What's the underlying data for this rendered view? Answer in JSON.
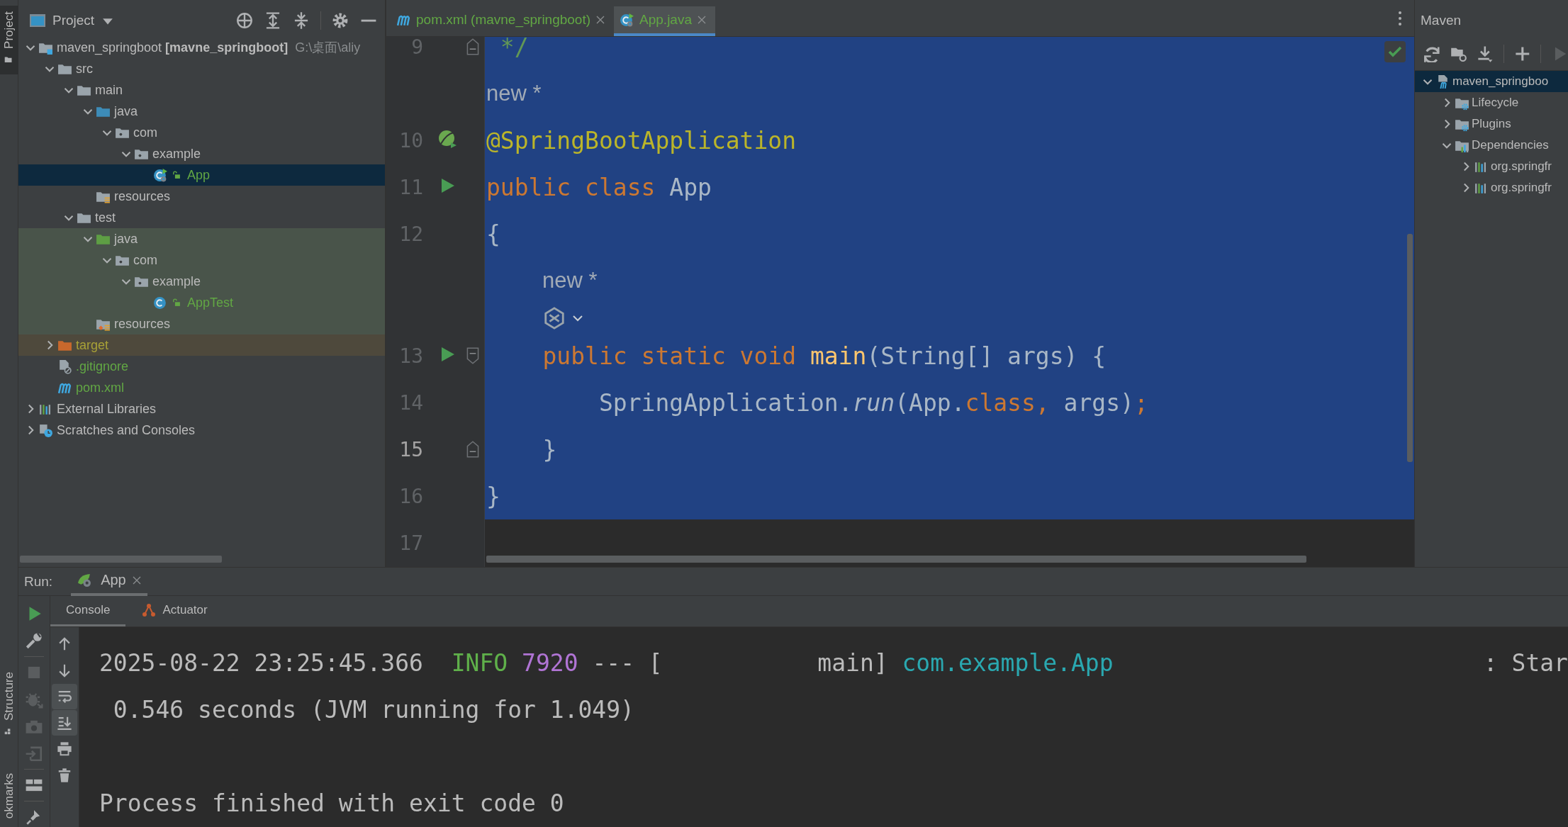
{
  "tool_strip": {
    "top": [
      {
        "label": "Project",
        "selected": true
      }
    ],
    "bottom": [
      {
        "label": "Structure",
        "selected": false
      },
      {
        "label": "okmarks",
        "selected": false
      }
    ]
  },
  "project": {
    "title": "Project",
    "tree": [
      {
        "label": "maven_springboot **[mavne_springboot]**",
        "hint": "G:\\桌面\\aliy",
        "kind": "module",
        "expanded": true,
        "selected": false,
        "children": [
          {
            "label": "src",
            "kind": "folder",
            "expanded": true,
            "selected": false,
            "children": [
              {
                "label": "main",
                "kind": "folder",
                "expanded": true,
                "selected": false,
                "children": [
                  {
                    "label": "java",
                    "kind": "source",
                    "expanded": true,
                    "selected": false,
                    "children": [
                      {
                        "label": "com",
                        "kind": "package",
                        "expanded": true,
                        "selected": false,
                        "children": [
                          {
                            "label": "example",
                            "kind": "package",
                            "expanded": true,
                            "selected": false,
                            "children": [
                              {
                                "label": "App",
                                "kind": "spring-class",
                                "color": "#62a744",
                                "selected": true
                              }
                            ]
                          }
                        ]
                      }
                    ]
                  },
                  {
                    "label": "resources",
                    "kind": "resources",
                    "selected": false
                  }
                ]
              },
              {
                "label": "test",
                "kind": "folder",
                "expanded": true,
                "selected": false,
                "children": [
                  {
                    "label": "java",
                    "kind": "test-source",
                    "in_tests": true,
                    "expanded": true,
                    "selected": false,
                    "children": [
                      {
                        "label": "com",
                        "kind": "package",
                        "in_tests": true,
                        "expanded": true,
                        "selected": false,
                        "children": [
                          {
                            "label": "example",
                            "kind": "package",
                            "in_tests": true,
                            "expanded": true,
                            "selected": false,
                            "children": [
                              {
                                "label": "AppTest",
                                "kind": "class",
                                "in_tests": true,
                                "color": "#62a744",
                                "selected": false
                              }
                            ]
                          }
                        ]
                      }
                    ]
                  },
                  {
                    "label": "resources",
                    "kind": "test-resources",
                    "in_tests": true,
                    "selected": false
                  }
                ]
              }
            ]
          },
          {
            "label": "target",
            "kind": "excluded",
            "excluded": true,
            "color": "#a8a137",
            "expanded": false,
            "selected": false
          },
          {
            "label": ".gitignore",
            "kind": "gitignore",
            "color": "#62a744",
            "selected": false
          },
          {
            "label": "pom.xml",
            "kind": "maven",
            "color": "#62a744",
            "selected": false
          }
        ]
      },
      {
        "label": "External Libraries",
        "kind": "libraries",
        "expanded": false,
        "selected": false
      },
      {
        "label": "Scratches and Consoles",
        "kind": "scratches",
        "expanded": false,
        "selected": false
      }
    ]
  },
  "editor": {
    "tabs": [
      {
        "label": "pom.xml (mavne_springboot)",
        "kind": "maven",
        "color": "#62a744",
        "selected": false
      },
      {
        "label": "App.java",
        "kind": "spring-class",
        "color": "#62a744",
        "selected": true
      }
    ],
    "lines": [
      {
        "kind": "code",
        "number": "9",
        "selected": true,
        "current": false,
        "fold": {
          "kind": "end"
        },
        "tokens": [
          {
            "text": " */",
            "kind": "comment"
          }
        ]
      },
      {
        "kind": "hint",
        "text": "new *",
        "inside_class": false,
        "selected": true
      },
      {
        "kind": "code",
        "number": "10",
        "selected": true,
        "current": false,
        "gutter": {
          "kind": "bean"
        },
        "tokens": [
          {
            "text": "@SpringBootApplication",
            "kind": "annotation"
          }
        ]
      },
      {
        "kind": "code",
        "number": "11",
        "selected": true,
        "current": false,
        "gutter": {
          "kind": "run"
        },
        "tokens": [
          {
            "text": "public class",
            "kind": "keyword"
          },
          {
            "text": " App",
            "kind": "plain"
          }
        ]
      },
      {
        "kind": "code",
        "number": "12",
        "selected": true,
        "current": false,
        "tokens": [
          {
            "text": "{",
            "kind": "plain"
          }
        ]
      },
      {
        "kind": "hint",
        "text": "new *",
        "inside_class": true,
        "selected": true
      },
      {
        "kind": "ai-hint",
        "inside_class": true,
        "selected": true
      },
      {
        "kind": "code",
        "number": "13",
        "selected": true,
        "current": false,
        "gutter": {
          "kind": "run"
        },
        "fold": {
          "kind": "start"
        },
        "tokens": [
          {
            "text": "    public static void",
            "kind": "keyword"
          },
          {
            "text": " main",
            "kind": "method"
          },
          {
            "text": "(String[] args) {",
            "kind": "plain"
          }
        ]
      },
      {
        "kind": "code",
        "number": "14",
        "selected": true,
        "current": false,
        "tokens": [
          {
            "text": "        SpringApplication.",
            "kind": "plain"
          },
          {
            "text": "run",
            "kind": "static-call"
          },
          {
            "text": "(App.",
            "kind": "plain"
          },
          {
            "text": "class,",
            "kind": "keyword"
          },
          {
            "text": " args)",
            "kind": "plain"
          },
          {
            "text": ";",
            "kind": "keyword"
          }
        ]
      },
      {
        "kind": "code",
        "number": "15",
        "selected": true,
        "current": true,
        "fold": {
          "kind": "end"
        },
        "tokens": [
          {
            "text": "    }",
            "kind": "plain"
          }
        ]
      },
      {
        "kind": "code",
        "number": "16",
        "selected": true,
        "current": false,
        "tokens": [
          {
            "text": "}",
            "kind": "plain"
          }
        ]
      },
      {
        "kind": "code",
        "number": "17",
        "selected": false,
        "current": false
      }
    ]
  },
  "maven": {
    "title": "Maven",
    "tree": [
      {
        "label": "maven_springboo",
        "kind": "maven-module",
        "expanded": true,
        "selected": true,
        "children": [
          {
            "label": "Lifecycle",
            "kind": "lifecycle",
            "expanded": false,
            "selected": false
          },
          {
            "label": "Plugins",
            "kind": "plugins",
            "expanded": false,
            "selected": false
          },
          {
            "label": "Dependencies",
            "kind": "dependencies",
            "expanded": true,
            "selected": false,
            "children": [
              {
                "label": "org.springfr",
                "kind": "dependency",
                "expanded": false,
                "selected": false
              },
              {
                "label": "org.springfr",
                "kind": "dependency",
                "expanded": false,
                "selected": false
              }
            ]
          }
        ]
      }
    ]
  },
  "run": {
    "label": "Run:",
    "tabs": [
      {
        "label": "App",
        "selected": true
      }
    ],
    "subtabs": [
      {
        "label": "Console",
        "kind": "plain",
        "selected": true
      },
      {
        "label": "Actuator",
        "kind": "actuator",
        "selected": false
      }
    ],
    "actions": [
      {
        "kind": "run",
        "disabled": false
      },
      {
        "kind": "settings",
        "disabled": false
      },
      {
        "kind": "separator"
      },
      {
        "kind": "stop",
        "disabled": true
      },
      {
        "kind": "debug",
        "disabled": true
      },
      {
        "kind": "camera",
        "disabled": true
      },
      {
        "kind": "import",
        "disabled": true
      },
      {
        "kind": "separator"
      },
      {
        "kind": "layout",
        "disabled": false
      },
      {
        "kind": "separator"
      },
      {
        "kind": "pin",
        "disabled": false
      }
    ],
    "console_actions": [
      {
        "kind": "up",
        "on": false
      },
      {
        "kind": "down",
        "on": false
      },
      {
        "kind": "wrap",
        "on": true
      },
      {
        "kind": "scroll-end",
        "on": true
      },
      {
        "kind": "print",
        "on": false
      },
      {
        "kind": "clear",
        "on": false
      }
    ],
    "console": [
      {
        "lines": [
          {
            "segments": [
              {
                "text": "2025-08-22 23:25:45.366",
                "kind": "plain"
              },
              {
                "text": "  INFO",
                "kind": "level"
              },
              {
                "text": " 7920",
                "kind": "pid"
              },
              {
                "text": " --- [           main]",
                "kind": "plain"
              },
              {
                "text": " com.example.App",
                "kind": "logger"
              },
              {
                "text": ": Star",
                "kind": "message"
              }
            ]
          },
          {
            "segments": [
              {
                "text": " 0.546 seconds (JVM running for 1.049)",
                "kind": "plain"
              }
            ]
          }
        ]
      },
      {
        "lines": [
          {
            "segments": [
              {
                "text": "Process finished with exit code 0",
                "kind": "plain"
              }
            ]
          }
        ]
      }
    ]
  }
}
